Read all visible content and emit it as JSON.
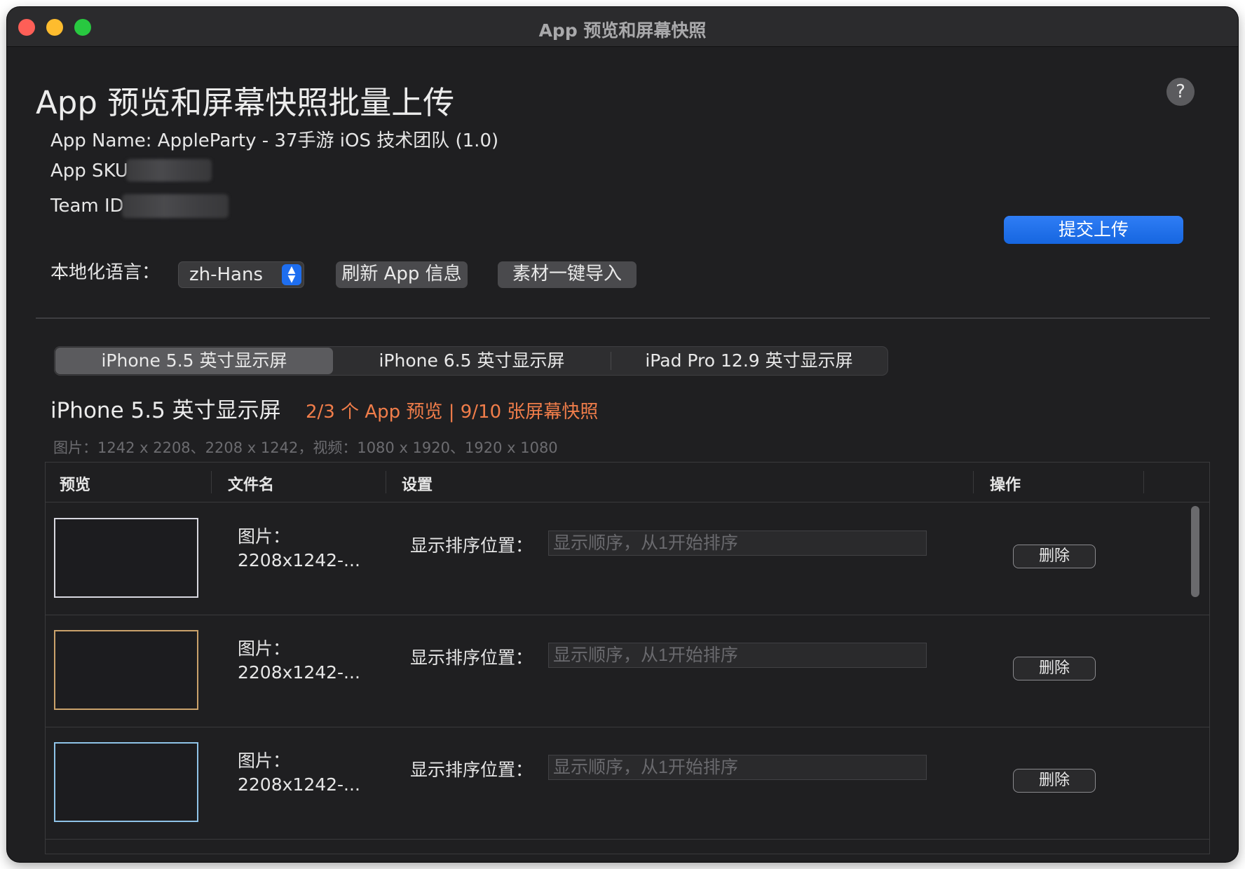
{
  "window": {
    "title": "App 预览和屏幕快照"
  },
  "header": {
    "title": "App 预览和屏幕快照批量上传",
    "help_label": "?"
  },
  "app_info": {
    "name_line": "App Name: AppleParty - 37手游 iOS 技术团队 (1.0)",
    "sku_label": "App SKU:",
    "team_label": "Team ID:"
  },
  "toolbar": {
    "language_label": "本地化语言：",
    "language_value": "zh-Hans",
    "refresh_label": "刷新 App 信息",
    "import_label": "素材一键导入",
    "submit_label": "提交上传"
  },
  "tabs": [
    {
      "label": "iPhone 5.5 英寸显示屏",
      "active": true
    },
    {
      "label": "iPhone 6.5 英寸显示屏",
      "active": false
    },
    {
      "label": "iPad Pro 12.9 英寸显示屏",
      "active": false
    }
  ],
  "section": {
    "title": "iPhone 5.5 英寸显示屏",
    "count": "2/3 个 App 预览 | 9/10 张屏幕快照",
    "spec": "图片：1242 x 2208、2208 x 1242，视频：1080 x 1920、1920 x 1080"
  },
  "table": {
    "columns": [
      "预览",
      "文件名",
      "设置",
      "操作"
    ],
    "rows": [
      {
        "file_type": "图片：",
        "file_name": "2208x1242-...",
        "setting_label": "显示排序位置：",
        "placeholder": "显示顺序，从1开始排序",
        "action": "删除"
      },
      {
        "file_type": "图片：",
        "file_name": "2208x1242-...",
        "setting_label": "显示排序位置：",
        "placeholder": "显示顺序，从1开始排序",
        "action": "删除"
      },
      {
        "file_type": "图片：",
        "file_name": "2208x1242-...",
        "setting_label": "显示排序位置：",
        "placeholder": "显示顺序，从1开始排序",
        "action": "删除"
      }
    ]
  },
  "colors": {
    "accent": "#1e6ef0",
    "highlight": "#f07d4a",
    "background": "#1f1f21"
  }
}
